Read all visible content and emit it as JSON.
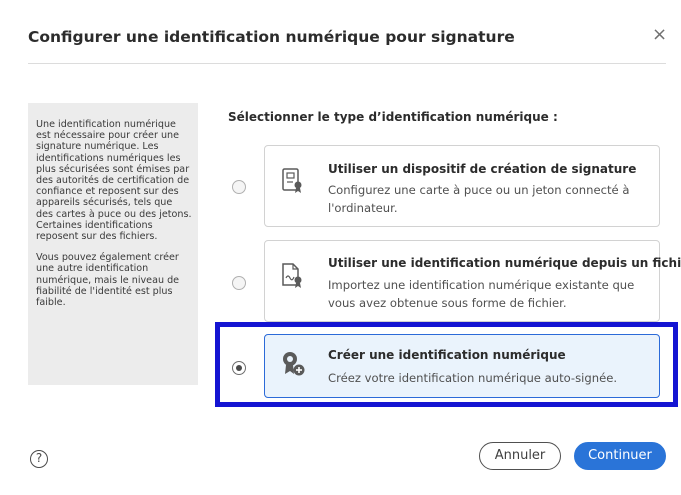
{
  "dialog": {
    "title": "Configurer une identification numérique pour signature",
    "close_icon": "×"
  },
  "info": {
    "paragraph1": "Une identification numérique est nécessaire pour créer une signature numérique. Les identifications numériques les plus sécurisées sont émises par des autorités de certification de confiance et reposent sur des appareils sécurisés, tels que des cartes à puce ou des jetons. Certaines identifications reposent sur des fichiers.",
    "paragraph2": "Vous pouvez également créer une autre identification numérique, mais le niveau de fiabilité de l'identité est plus faible."
  },
  "section_label": "Sélectionner le type d’identification numérique :",
  "options": [
    {
      "title": "Utiliser un dispositif de création de signature",
      "description": "Configurez une carte à puce ou un jeton connecté à l'ordinateur.",
      "icon": "smartcard-certificate-icon",
      "selected": false
    },
    {
      "title": "Utiliser une identification numérique depuis un fichier",
      "description": "Importez une identification numérique existante que vous avez obtenue sous forme de fichier.",
      "icon": "file-certificate-icon",
      "selected": false
    },
    {
      "title": "Créer une identification numérique",
      "description": "Créez votre identification numérique auto-signée.",
      "icon": "badge-add-icon",
      "selected": true
    }
  ],
  "footer": {
    "help_icon": "?",
    "cancel_label": "Annuler",
    "continue_label": "Continuer"
  },
  "colors": {
    "accent": "#2a74d8",
    "highlight_border": "#1414d2",
    "selected_bg": "#eaf3fc"
  }
}
